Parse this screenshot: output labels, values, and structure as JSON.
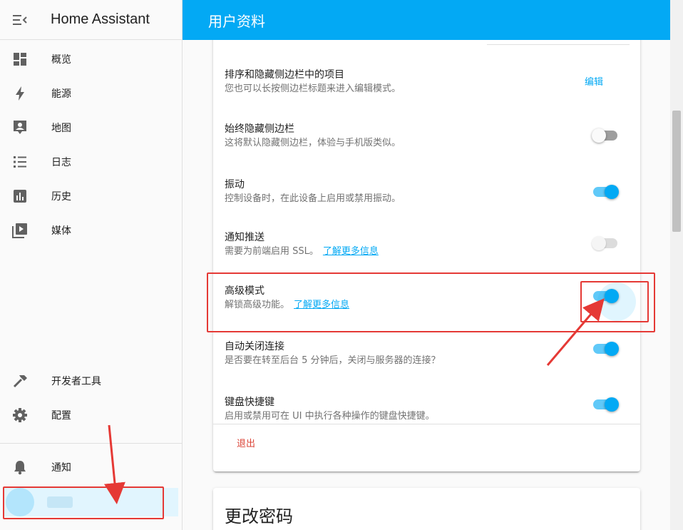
{
  "app": {
    "title": "Home Assistant"
  },
  "sidebar": {
    "items": [
      {
        "label": "概览",
        "icon": "dashboard-icon"
      },
      {
        "label": "能源",
        "icon": "lightning-bolt-icon"
      },
      {
        "label": "地图",
        "icon": "map-account-icon"
      },
      {
        "label": "日志",
        "icon": "format-list-bulleted-icon"
      },
      {
        "label": "历史",
        "icon": "chart-box-icon"
      },
      {
        "label": "媒体",
        "icon": "play-box-multiple-icon"
      }
    ],
    "bottom_items": [
      {
        "label": "开发者工具",
        "icon": "hammer-icon"
      },
      {
        "label": "配置",
        "icon": "cog-icon"
      }
    ],
    "notifications": {
      "label": "通知",
      "icon": "bell-icon"
    }
  },
  "header": {
    "title": "用户资料"
  },
  "settings": [
    {
      "heading": "排序和隐藏侧边栏中的项目",
      "desc": "您也可以长按侧边栏标题来进入编辑模式。",
      "action": "编辑"
    },
    {
      "heading": "始终隐藏侧边栏",
      "desc": "这将默认隐藏侧边栏，体验与手机版类似。",
      "state": "off"
    },
    {
      "heading": "振动",
      "desc": "控制设备时，在此设备上启用或禁用振动。",
      "state": "on"
    },
    {
      "heading": "通知推送",
      "desc": "需要为前端启用 SSL。",
      "link": "了解更多信息",
      "state": "disabled"
    },
    {
      "heading": "高级模式",
      "desc": "解锁高级功能。",
      "link": "了解更多信息",
      "state": "on"
    },
    {
      "heading": "自动关闭连接",
      "desc": "是否要在转至后台 5 分钟后，关闭与服务器的连接？",
      "state": "on"
    },
    {
      "heading": "键盘快捷键",
      "desc": "启用或禁用可在 UI 中执行各种操作的键盘快捷键。",
      "state": "on"
    }
  ],
  "logout_label": "退出",
  "change_password": {
    "title": "更改密码"
  },
  "colors": {
    "primary": "#03a9f4",
    "annotation": "#e53935",
    "logout": "#db4437"
  }
}
